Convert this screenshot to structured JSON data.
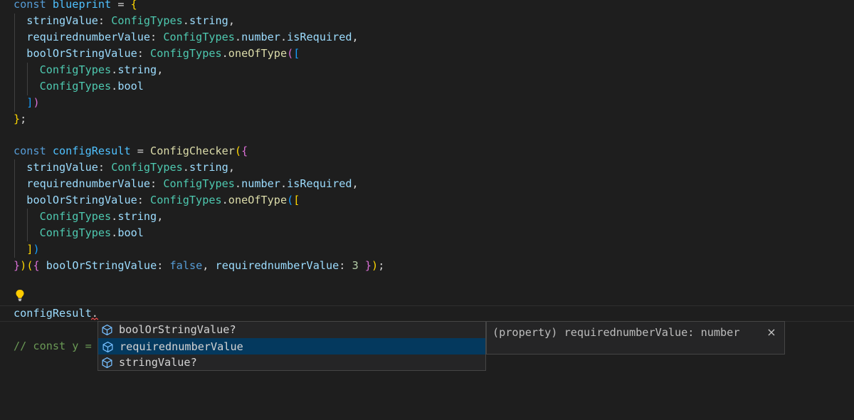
{
  "code": {
    "l1": {
      "kw": "const",
      "name": "blueprint",
      "eq": " = ",
      "brace": "{"
    },
    "l2": {
      "prop": "stringValue",
      "sep": ": ",
      "type": "ConfigTypes",
      "dot": ".",
      "member": "string",
      "end": ","
    },
    "l3": {
      "prop": "requirednumberValue",
      "sep": ": ",
      "type": "ConfigTypes",
      "dot": ".",
      "member": "number",
      "dot2": ".",
      "member2": "isRequired",
      "end": ","
    },
    "l4": {
      "prop": "boolOrStringValue",
      "sep": ": ",
      "type": "ConfigTypes",
      "dot": ".",
      "fn": "oneOfType",
      "paren": "(",
      "bracket": "["
    },
    "l5": {
      "type": "ConfigTypes",
      "dot": ".",
      "member": "string",
      "end": ","
    },
    "l6": {
      "type": "ConfigTypes",
      "dot": ".",
      "member": "bool"
    },
    "l7": {
      "bracket": "]",
      "paren": ")"
    },
    "l8": {
      "brace": "}",
      "end": ";"
    },
    "l10": {
      "kw": "const",
      "name": "configResult",
      "eq": " = ",
      "fn": "ConfigChecker",
      "paren": "(",
      "brace": "{"
    },
    "l11": {
      "prop": "stringValue",
      "sep": ": ",
      "type": "ConfigTypes",
      "dot": ".",
      "member": "string",
      "end": ","
    },
    "l12": {
      "prop": "requirednumberValue",
      "sep": ": ",
      "type": "ConfigTypes",
      "dot": ".",
      "member": "number",
      "dot2": ".",
      "member2": "isRequired",
      "end": ","
    },
    "l13": {
      "prop": "boolOrStringValue",
      "sep": ": ",
      "type": "ConfigTypes",
      "dot": ".",
      "fn": "oneOfType",
      "paren": "(",
      "bracket": "["
    },
    "l14": {
      "type": "ConfigTypes",
      "dot": ".",
      "member": "string",
      "end": ","
    },
    "l15": {
      "type": "ConfigTypes",
      "dot": ".",
      "member": "bool"
    },
    "l16": {
      "bracket": "]",
      "paren": ")"
    },
    "l17": {
      "brace": "}",
      "paren": ")",
      "paren2": "(",
      "brace2": "{",
      "prop": "boolOrStringValue",
      "sep": ": ",
      "kwfalse": "false",
      "comma": ", ",
      "prop2": "requirednumberValue",
      "sep2": ": ",
      "num": "3",
      "sp": " ",
      "brace3": "}",
      "paren3": ")",
      "end": ";"
    },
    "l19": {
      "name": "configResult",
      "dot": "."
    },
    "l20": {
      "comment": "// const y = "
    }
  },
  "suggest": {
    "items": [
      {
        "label": "boolOrStringValue?",
        "match": "",
        "icon": "property-icon"
      },
      {
        "label": "requirednumberValue",
        "match": "",
        "icon": "property-icon"
      },
      {
        "label": "stringValue?",
        "match": "",
        "icon": "property-icon"
      }
    ],
    "selected_index": 1,
    "details": "(property) requirednumberValue: number",
    "close": "×"
  },
  "colors": {
    "background": "#1e1e1e",
    "keyword": "#569cd6",
    "variable": "#4fc1ff",
    "property": "#9cdcfe",
    "type": "#4ec9b0",
    "function": "#dcdcaa",
    "number": "#b5cea8",
    "comment": "#6a9955",
    "selection": "#04395e",
    "widget_bg": "#252526"
  }
}
